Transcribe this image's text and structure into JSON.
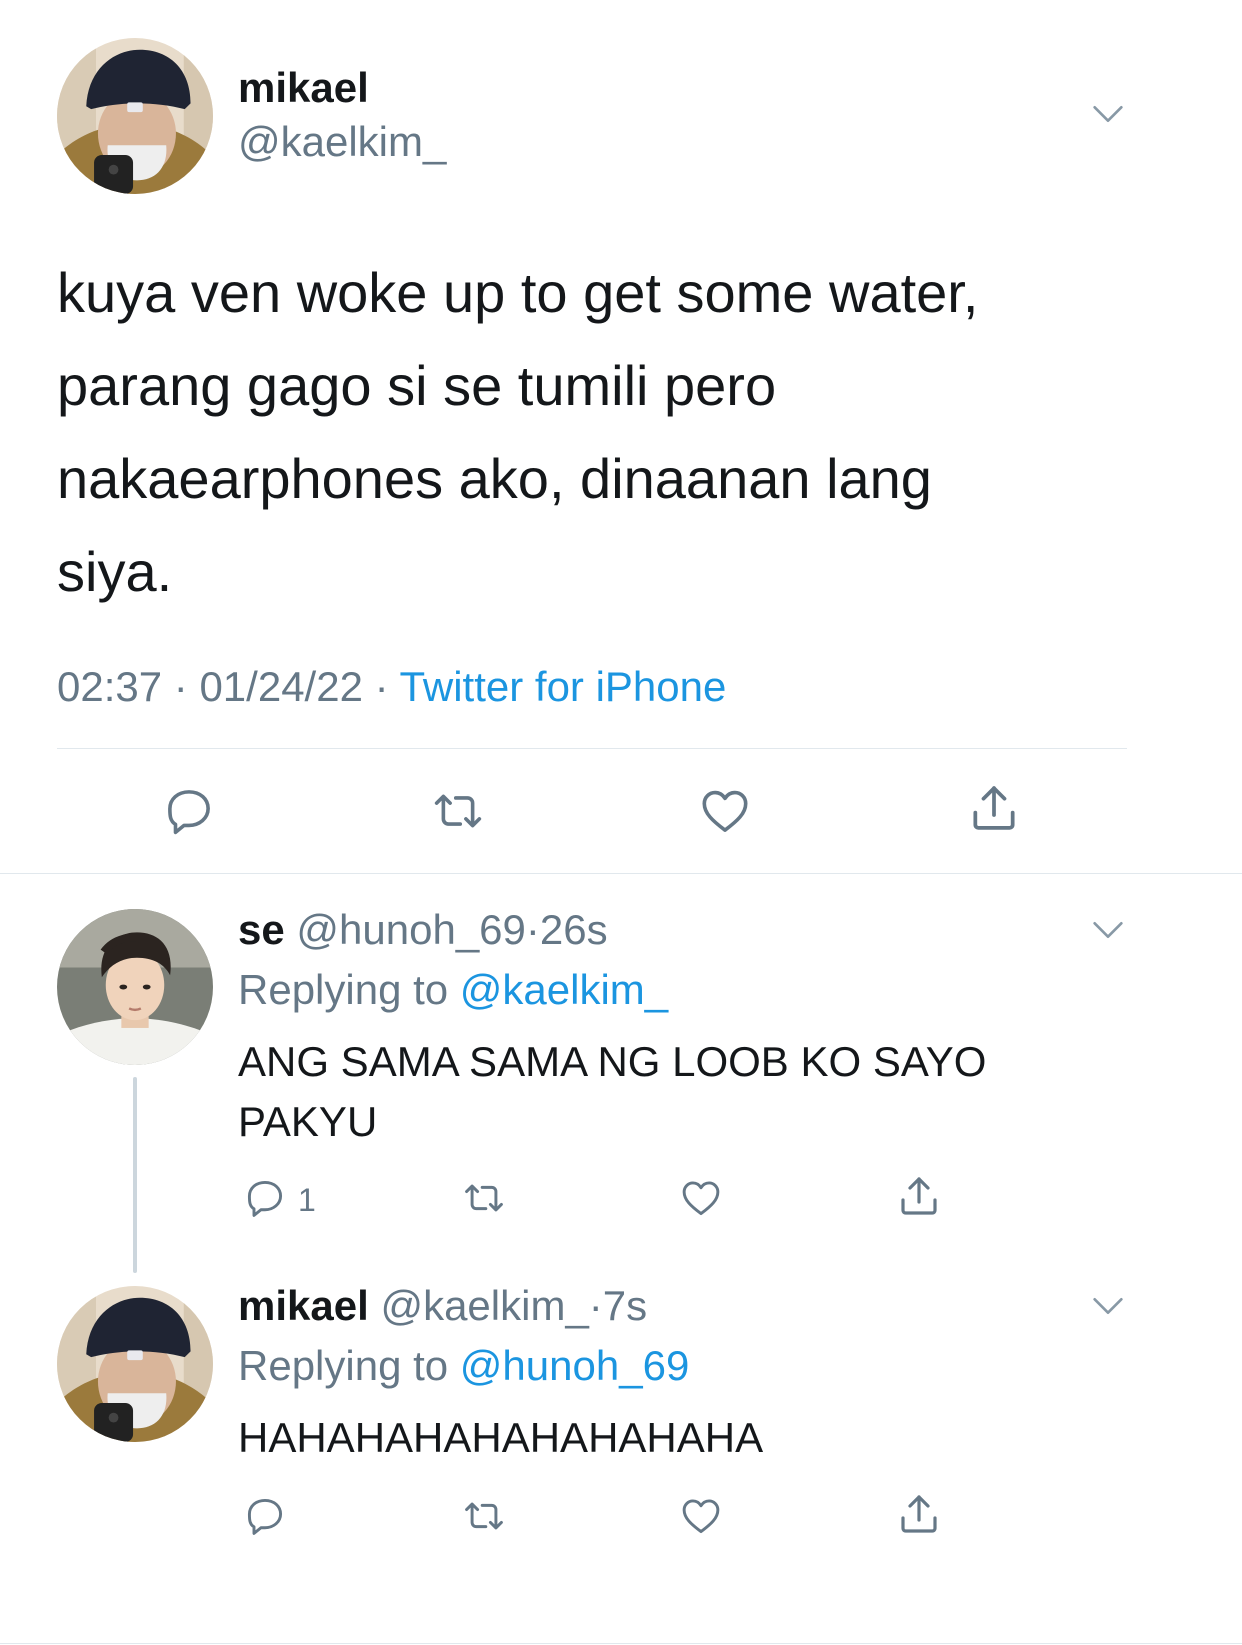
{
  "main_tweet": {
    "author_name": "mikael",
    "handle": "@kaelkim_",
    "text_lines": [
      "kuya ven woke up to get some water,",
      "parang gago si se tumili pero",
      "nakaearphones ako, dinaanan lang",
      "siya."
    ],
    "time": "02:37",
    "date": "01/24/22",
    "separator": "·",
    "source": "Twitter for iPhone"
  },
  "replies": [
    {
      "author_name": "se",
      "handle": "@hunoh_69",
      "dot": "·",
      "age": "26s",
      "replying_prefix": "Replying to",
      "replying_to": "@kaelkim_",
      "text_lines": [
        "ANG SAMA SAMA NG LOOB KO SAYO",
        "PAKYU"
      ],
      "reply_count": "1"
    },
    {
      "author_name": "mikael",
      "handle": "@kaelkim_",
      "dot": "·",
      "age": "7s",
      "replying_prefix": "Replying to",
      "replying_to": "@hunoh_69",
      "text_lines": [
        "HAHAHAHAHAHAHAHAHA"
      ],
      "reply_count": ""
    }
  ],
  "icons": {
    "reply": "reply-icon",
    "retweet": "retweet-icon",
    "like": "heart-icon",
    "share": "share-icon",
    "more": "chevron-down-icon"
  },
  "colors": {
    "link": "#1b95e0",
    "secondary": "#657786",
    "divider": "#e1e8ed",
    "thread": "#ccd6dd"
  }
}
